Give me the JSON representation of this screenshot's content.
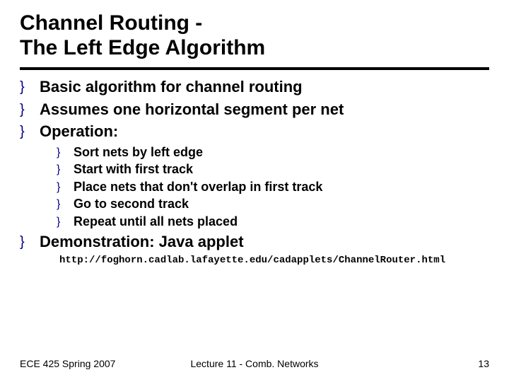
{
  "title_line1": "Channel Routing -",
  "title_line2": "The Left Edge Algorithm",
  "bullets": {
    "b1": "Basic algorithm for channel routing",
    "b2": "Assumes one horizontal segment per net",
    "b3": "Operation:",
    "sub": {
      "s1": "Sort nets by left edge",
      "s2": "Start with first track",
      "s3": "Place nets that don't overlap in first track",
      "s4": "Go to second track",
      "s5": "Repeat until all nets placed"
    },
    "b4": "Demonstration: Java applet"
  },
  "url": "http://foghorn.cadlab.lafayette.edu/cadapplets/ChannelRouter.html",
  "footer": {
    "left": "ECE 425 Spring 2007",
    "center": "Lecture 11 - Comb. Networks",
    "right": "13"
  },
  "bullet_char": "}"
}
